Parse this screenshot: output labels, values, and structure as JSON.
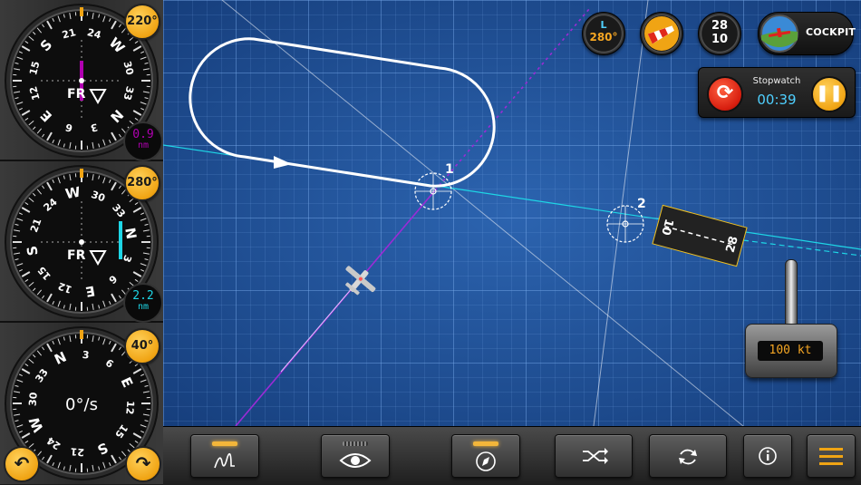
{
  "gauges": [
    {
      "badge": "220°",
      "distance_value": "0.9",
      "distance_unit": "nm",
      "distance_color": "#b000b0",
      "rose_labels": [
        "21",
        "24",
        "W",
        "30",
        "33",
        "N",
        "3",
        "6",
        "E",
        "12",
        "15",
        "S"
      ],
      "center_label": "FR"
    },
    {
      "badge": "280°",
      "distance_value": "2.2",
      "distance_unit": "nm",
      "distance_color": "#1ed6e6",
      "rose_labels": [
        "W",
        "30",
        "33",
        "N",
        "3",
        "6",
        "E",
        "12",
        "15",
        "S",
        "21",
        "24"
      ],
      "center_label": "FR"
    },
    {
      "badge": "40°",
      "center_label": "0°/s",
      "rose_labels": [
        "N",
        "3",
        "6",
        "E",
        "12",
        "15",
        "S",
        "21",
        "24",
        "W",
        "30",
        "33"
      ]
    }
  ],
  "top_buttons": {
    "wind_letter": "L",
    "wind_direction": "280°",
    "runway_top": "28",
    "runway_bottom": "10",
    "cockpit_label": "COCKPIT"
  },
  "stopwatch": {
    "title": "Stopwatch",
    "time": "00:39"
  },
  "map": {
    "waypoint_1": "1",
    "waypoint_2": "2",
    "runway_left_number": "10",
    "runway_right_number": "28"
  },
  "throttle": {
    "speed": "100 kt"
  },
  "colors": {
    "accent": "#f0a414",
    "map_bg": "#1e4f96",
    "track_magenta": "#9b2bd6",
    "course_cyan": "#1ed6e6"
  }
}
